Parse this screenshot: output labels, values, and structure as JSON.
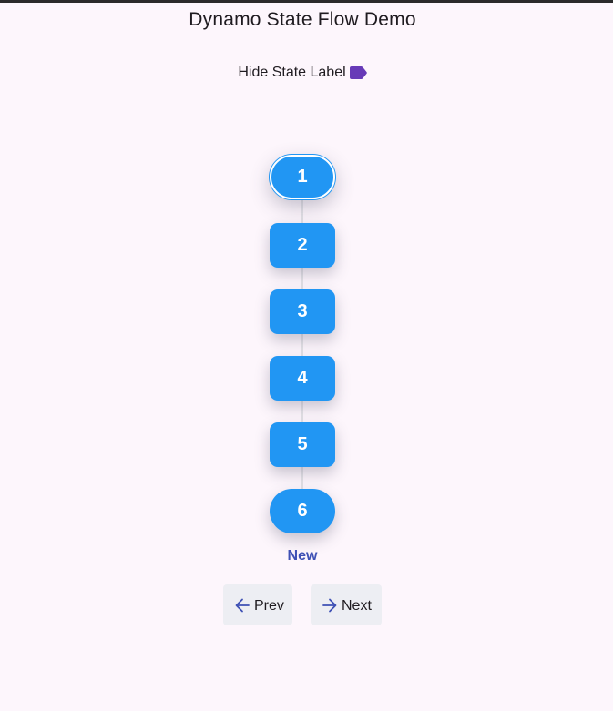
{
  "app": {
    "title": "Dynamo State Flow Demo"
  },
  "toggle": {
    "label": "Hide State Label",
    "icon": "label-icon",
    "icon_color": "#673ab7"
  },
  "flow": {
    "node_color": "#2196f3",
    "states": [
      {
        "label": "1",
        "shape": "pill",
        "current": true
      },
      {
        "label": "2",
        "shape": "rounded",
        "current": false
      },
      {
        "label": "3",
        "shape": "rounded",
        "current": false
      },
      {
        "label": "4",
        "shape": "rounded",
        "current": false
      },
      {
        "label": "5",
        "shape": "rounded",
        "current": false
      },
      {
        "label": "6",
        "shape": "pill",
        "current": false
      }
    ],
    "current_state_caption": "New",
    "caption_color": "#3f51b5"
  },
  "nav": {
    "prev_label": "Prev",
    "prev_icon": "arrow-left-icon",
    "next_label": "Next",
    "next_icon": "arrow-right-icon",
    "icon_color": "#3f51b5"
  }
}
